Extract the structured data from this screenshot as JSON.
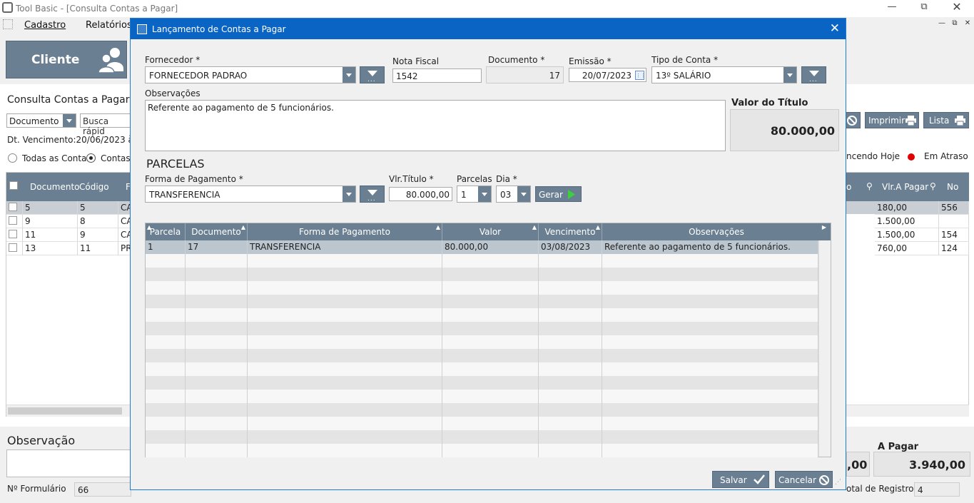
{
  "window": {
    "title": "Tool Basic - [Consulta Contas a Pagar]"
  },
  "menu": {
    "cadastro": "Cadastro",
    "relatorios": "Relatórios"
  },
  "cliente_button": "Cliente",
  "bg": {
    "title": "Consulta Contas a Pagar",
    "filter_field": "Documento",
    "search_placeholder": "Busca rápid",
    "due_range": "Dt. Vencimento:20/06/2023 à",
    "radio_all": "Todas as Contas",
    "radio_open": "Contas a",
    "imprimir": "Imprimir",
    "lista": "Lista",
    "legend_today": "ncendo Hoje",
    "legend_late": "Em Atraso",
    "headers": {
      "documento": "Documento",
      "codigo": "Código",
      "f": "F",
      "o": "o",
      "vlr": "Vlr.A Pagar",
      "no": "No"
    },
    "rows": [
      {
        "doc": "5",
        "cod": "5",
        "f": "CA",
        "vlr": "180,00",
        "no": "556"
      },
      {
        "doc": "9",
        "cod": "8",
        "f": "CA",
        "vlr": "1.500,00",
        "no": ""
      },
      {
        "doc": "11",
        "cod": "9",
        "f": "CA",
        "vlr": "1.500,00",
        "no": "154"
      },
      {
        "doc": "13",
        "cod": "11",
        "f": "PR",
        "vlr": "760,00",
        "no": "124"
      }
    ],
    "observacao_label": "Observação",
    "formulario_label": "Nº Formulário",
    "formulario_value": "66",
    "total_partial": ",00",
    "a_pagar_label": "A Pagar",
    "a_pagar_value": "3.940,00",
    "registros_label": "otal de Registros",
    "registros_value": "4"
  },
  "dialog": {
    "title": "Lançamento de Contas a Pagar",
    "fornecedor_label": "Fornecedor *",
    "fornecedor_value": "FORNECEDOR PADRAO",
    "nota_label": "Nota Fiscal",
    "nota_value": "1542",
    "documento_label": "Documento *",
    "documento_value": "17",
    "emissao_label": "Emissão *",
    "emissao_value": "20/07/2023",
    "tipo_label": "Tipo de Conta *",
    "tipo_value": "13º SALÁRIO",
    "obs_label": "Observações",
    "obs_value": "Referente ao pagamento de 5 funcionários.",
    "valor_label": "Valor do Título",
    "valor_value": "80.000,00",
    "parcelas_section": "PARCELAS",
    "forma_label": "Forma de Pagamento *",
    "forma_value": "TRANSFERENCIA",
    "vlr_titulo_label": "Vlr.Título *",
    "vlr_titulo_value": "80.000,00",
    "parcelas_label": "Parcelas",
    "parcelas_value": "1",
    "dia_label": "Dia *",
    "dia_value": "03",
    "gerar": "Gerar",
    "grid_headers": {
      "parcela": "Parcela",
      "documento": "Documento",
      "forma": "Forma de Pagamento",
      "valor": "Valor",
      "vencimento": "Vencimento",
      "obs": "Observações"
    },
    "grid_rows": [
      {
        "parcela": "1",
        "documento": "17",
        "forma": "TRANSFERENCIA",
        "valor": "80.000,00",
        "vencimento": "03/08/2023",
        "obs": "Referente ao pagamento de 5 funcionários."
      }
    ],
    "salvar": "Salvar",
    "cancelar": "Cancelar"
  }
}
